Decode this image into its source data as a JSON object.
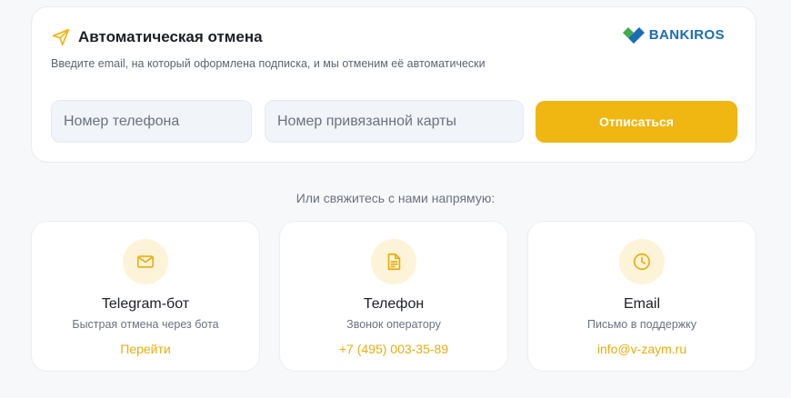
{
  "cancel": {
    "title": "Автоматическая отмена",
    "subtitle": "Введите email, на который оформлена подписка, и мы отменим её автоматически",
    "brand": "BANKIROS",
    "phone_placeholder": "Номер телефона",
    "card_placeholder": "Номер привязанной карты",
    "submit_label": "Отписаться"
  },
  "contact": {
    "heading": "Или свяжитесь с нами напрямую:",
    "cards": [
      {
        "icon": "mail-icon",
        "title": "Telegram-бот",
        "subtitle": "Быстрая отмена через бота",
        "link": "Перейти"
      },
      {
        "icon": "document-icon",
        "title": "Телефон",
        "subtitle": "Звонок оператору",
        "link": "+7 (495) 003-35-89"
      },
      {
        "icon": "clock-icon",
        "title": "Email",
        "subtitle": "Письмо в поддержку",
        "link": "info@v-zaym.ru"
      }
    ]
  },
  "colors": {
    "accent": "#f0b611",
    "link": "#e9ae0c",
    "icon_bg": "#fdf3d8",
    "brand_blue": "#1b6db3",
    "brand_green": "#3fae49"
  }
}
